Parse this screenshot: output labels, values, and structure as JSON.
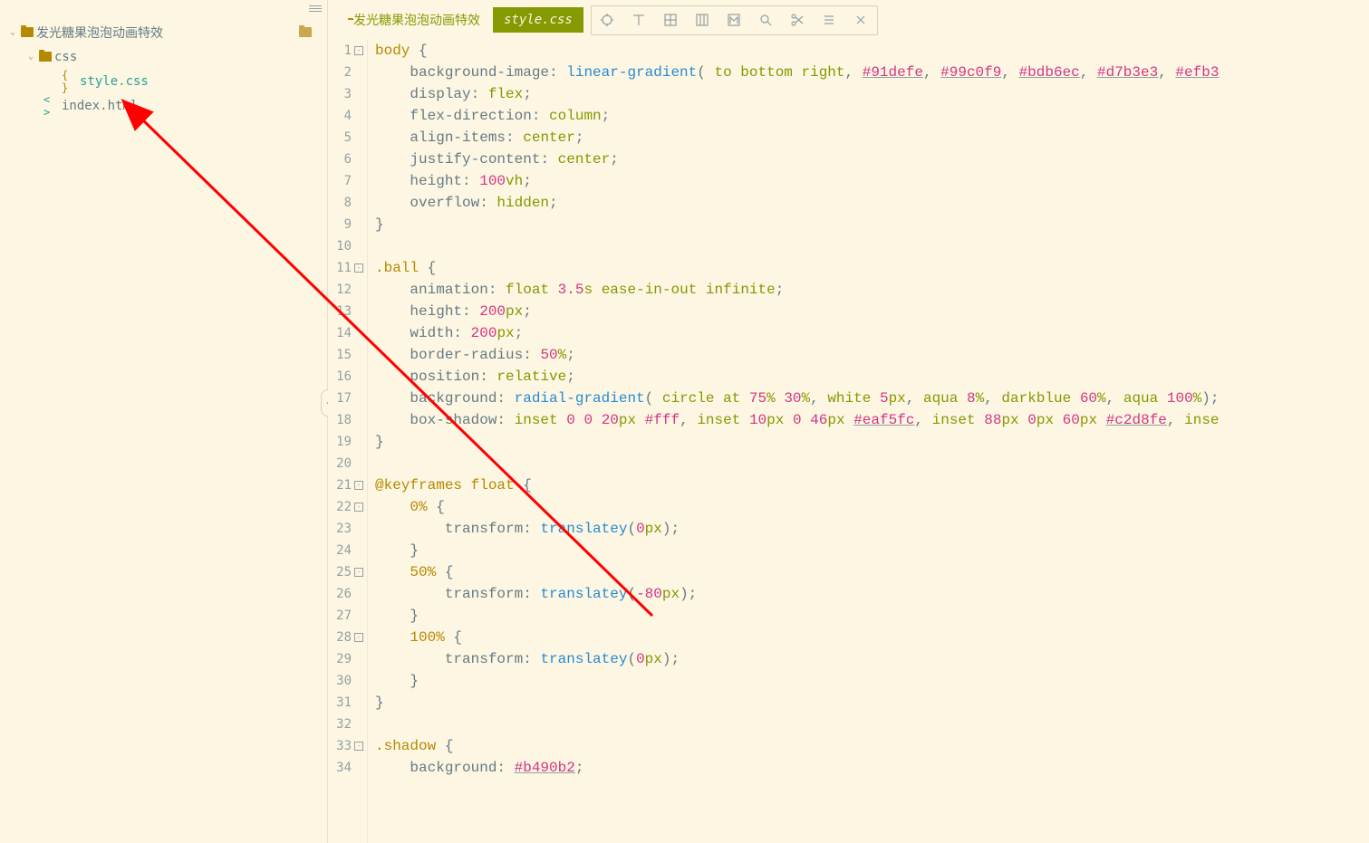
{
  "sidebar": {
    "root": {
      "label": "发光糖果泡泡动画特效"
    },
    "css_folder": {
      "label": "css"
    },
    "css_file": {
      "label": "style.css"
    },
    "html_file": {
      "label": "index.html"
    }
  },
  "tabs": {
    "folder": {
      "label": "发光糖果泡泡动画特效"
    },
    "active": {
      "label": "style.css"
    }
  },
  "toolbar_icons": [
    "target",
    "t",
    "grid4",
    "grid3col",
    "m",
    "search",
    "scissors",
    "menu",
    "close"
  ],
  "code": {
    "lines": [
      {
        "n": 1,
        "fold": "-",
        "tokens": [
          [
            "kw-sel",
            "body"
          ],
          [
            "punc",
            " "
          ],
          [
            "brace",
            "{"
          ]
        ]
      },
      {
        "n": 2,
        "tokens": [
          [
            "kw-prop",
            "    background-image"
          ],
          [
            "punc",
            ": "
          ],
          [
            "func",
            "linear-gradient"
          ],
          [
            "punc",
            "( "
          ],
          [
            "kw",
            "to"
          ],
          [
            "punc",
            " "
          ],
          [
            "kw",
            "bottom"
          ],
          [
            "punc",
            " "
          ],
          [
            "kw",
            "right"
          ],
          [
            "punc",
            ", "
          ],
          [
            "hex-u",
            "#91defe"
          ],
          [
            "punc",
            ", "
          ],
          [
            "hex-u",
            "#99c0f9"
          ],
          [
            "punc",
            ", "
          ],
          [
            "hex-u",
            "#bdb6ec"
          ],
          [
            "punc",
            ", "
          ],
          [
            "hex-u",
            "#d7b3e3"
          ],
          [
            "punc",
            ", "
          ],
          [
            "hex-u",
            "#efb3"
          ]
        ]
      },
      {
        "n": 3,
        "tokens": [
          [
            "kw-prop",
            "    display"
          ],
          [
            "punc",
            ": "
          ],
          [
            "kw",
            "flex"
          ],
          [
            "punc",
            ";"
          ]
        ]
      },
      {
        "n": 4,
        "tokens": [
          [
            "kw-prop",
            "    flex-direction"
          ],
          [
            "punc",
            ": "
          ],
          [
            "kw",
            "column"
          ],
          [
            "punc",
            ";"
          ]
        ]
      },
      {
        "n": 5,
        "tokens": [
          [
            "kw-prop",
            "    align-items"
          ],
          [
            "punc",
            ": "
          ],
          [
            "kw",
            "center"
          ],
          [
            "punc",
            ";"
          ]
        ]
      },
      {
        "n": 6,
        "tokens": [
          [
            "kw-prop",
            "    justify-content"
          ],
          [
            "punc",
            ": "
          ],
          [
            "kw",
            "center"
          ],
          [
            "punc",
            ";"
          ]
        ]
      },
      {
        "n": 7,
        "tokens": [
          [
            "kw-prop",
            "    height"
          ],
          [
            "punc",
            ": "
          ],
          [
            "num",
            "100"
          ],
          [
            "unit",
            "vh"
          ],
          [
            "punc",
            ";"
          ]
        ]
      },
      {
        "n": 8,
        "tokens": [
          [
            "kw-prop",
            "    overflow"
          ],
          [
            "punc",
            ": "
          ],
          [
            "kw",
            "hidden"
          ],
          [
            "punc",
            ";"
          ]
        ]
      },
      {
        "n": 9,
        "tokens": [
          [
            "brace",
            "}"
          ]
        ]
      },
      {
        "n": 10,
        "tokens": []
      },
      {
        "n": 11,
        "fold": "-",
        "tokens": [
          [
            "kw-sel",
            ".ball"
          ],
          [
            "punc",
            " "
          ],
          [
            "brace",
            "{"
          ]
        ]
      },
      {
        "n": 12,
        "tokens": [
          [
            "kw-prop",
            "    animation"
          ],
          [
            "punc",
            ": "
          ],
          [
            "kw",
            "float"
          ],
          [
            "punc",
            " "
          ],
          [
            "num",
            "3.5"
          ],
          [
            "unit",
            "s"
          ],
          [
            "punc",
            " "
          ],
          [
            "kw",
            "ease-in-out"
          ],
          [
            "punc",
            " "
          ],
          [
            "kw",
            "infinite"
          ],
          [
            "punc",
            ";"
          ]
        ]
      },
      {
        "n": 13,
        "tokens": [
          [
            "kw-prop",
            "    height"
          ],
          [
            "punc",
            ": "
          ],
          [
            "num",
            "200"
          ],
          [
            "unit",
            "px"
          ],
          [
            "punc",
            ";"
          ]
        ]
      },
      {
        "n": 14,
        "tokens": [
          [
            "kw-prop",
            "    width"
          ],
          [
            "punc",
            ": "
          ],
          [
            "num",
            "200"
          ],
          [
            "unit",
            "px"
          ],
          [
            "punc",
            ";"
          ]
        ]
      },
      {
        "n": 15,
        "tokens": [
          [
            "kw-prop",
            "    border-radius"
          ],
          [
            "punc",
            ": "
          ],
          [
            "num",
            "50"
          ],
          [
            "unit",
            "%"
          ],
          [
            "punc",
            ";"
          ]
        ]
      },
      {
        "n": 16,
        "tokens": [
          [
            "kw-prop",
            "    position"
          ],
          [
            "punc",
            ": "
          ],
          [
            "kw",
            "relative"
          ],
          [
            "punc",
            ";"
          ]
        ]
      },
      {
        "n": 17,
        "tokens": [
          [
            "kw-prop",
            "    background"
          ],
          [
            "punc",
            ": "
          ],
          [
            "func",
            "radial-gradient"
          ],
          [
            "punc",
            "( "
          ],
          [
            "kw",
            "circle"
          ],
          [
            "punc",
            " "
          ],
          [
            "kw",
            "at"
          ],
          [
            "punc",
            " "
          ],
          [
            "num",
            "75"
          ],
          [
            "unit",
            "%"
          ],
          [
            "punc",
            " "
          ],
          [
            "num",
            "30"
          ],
          [
            "unit",
            "%"
          ],
          [
            "punc",
            ", "
          ],
          [
            "kw",
            "white"
          ],
          [
            "punc",
            " "
          ],
          [
            "num",
            "5"
          ],
          [
            "unit",
            "px"
          ],
          [
            "punc",
            ", "
          ],
          [
            "kw",
            "aqua"
          ],
          [
            "punc",
            " "
          ],
          [
            "num",
            "8"
          ],
          [
            "unit",
            "%"
          ],
          [
            "punc",
            ", "
          ],
          [
            "kw",
            "darkblue"
          ],
          [
            "punc",
            " "
          ],
          [
            "num",
            "60"
          ],
          [
            "unit",
            "%"
          ],
          [
            "punc",
            ", "
          ],
          [
            "kw",
            "aqua"
          ],
          [
            "punc",
            " "
          ],
          [
            "num",
            "100"
          ],
          [
            "unit",
            "%"
          ],
          [
            "punc",
            ");"
          ]
        ]
      },
      {
        "n": 18,
        "tokens": [
          [
            "kw-prop",
            "    box-shadow"
          ],
          [
            "punc",
            ": "
          ],
          [
            "kw",
            "inset"
          ],
          [
            "punc",
            " "
          ],
          [
            "num",
            "0"
          ],
          [
            "punc",
            " "
          ],
          [
            "num",
            "0"
          ],
          [
            "punc",
            " "
          ],
          [
            "num",
            "20"
          ],
          [
            "unit",
            "px"
          ],
          [
            "punc",
            " "
          ],
          [
            "hex",
            "#fff"
          ],
          [
            "punc",
            ", "
          ],
          [
            "kw",
            "inset"
          ],
          [
            "punc",
            " "
          ],
          [
            "num",
            "10"
          ],
          [
            "unit",
            "px"
          ],
          [
            "punc",
            " "
          ],
          [
            "num",
            "0"
          ],
          [
            "punc",
            " "
          ],
          [
            "num",
            "46"
          ],
          [
            "unit",
            "px"
          ],
          [
            "punc",
            " "
          ],
          [
            "hex-u",
            "#eaf5fc"
          ],
          [
            "punc",
            ", "
          ],
          [
            "kw",
            "inset"
          ],
          [
            "punc",
            " "
          ],
          [
            "num",
            "88"
          ],
          [
            "unit",
            "px"
          ],
          [
            "punc",
            " "
          ],
          [
            "num",
            "0"
          ],
          [
            "unit",
            "px"
          ],
          [
            "punc",
            " "
          ],
          [
            "num",
            "60"
          ],
          [
            "unit",
            "px"
          ],
          [
            "punc",
            " "
          ],
          [
            "hex-u",
            "#c2d8fe"
          ],
          [
            "punc",
            ", "
          ],
          [
            "kw",
            "inse"
          ]
        ]
      },
      {
        "n": 19,
        "tokens": [
          [
            "brace",
            "}"
          ]
        ]
      },
      {
        "n": 20,
        "tokens": []
      },
      {
        "n": 21,
        "fold": "-",
        "tokens": [
          [
            "atrule",
            "@keyframes"
          ],
          [
            "punc",
            " "
          ],
          [
            "kw-sel",
            "float"
          ],
          [
            "punc",
            " "
          ],
          [
            "brace",
            "{"
          ]
        ]
      },
      {
        "n": 22,
        "fold": "-",
        "tokens": [
          [
            "kw-sel",
            "    0%"
          ],
          [
            "punc",
            " "
          ],
          [
            "brace",
            "{"
          ]
        ]
      },
      {
        "n": 23,
        "tokens": [
          [
            "kw-prop",
            "        transform"
          ],
          [
            "punc",
            ": "
          ],
          [
            "func",
            "translatey"
          ],
          [
            "punc",
            "("
          ],
          [
            "num",
            "0"
          ],
          [
            "unit",
            "px"
          ],
          [
            "punc",
            ");"
          ]
        ]
      },
      {
        "n": 24,
        "tokens": [
          [
            "brace",
            "    }"
          ]
        ]
      },
      {
        "n": 25,
        "fold": "-",
        "tokens": [
          [
            "kw-sel",
            "    50%"
          ],
          [
            "punc",
            " "
          ],
          [
            "brace",
            "{"
          ]
        ]
      },
      {
        "n": 26,
        "tokens": [
          [
            "kw-prop",
            "        transform"
          ],
          [
            "punc",
            ": "
          ],
          [
            "func",
            "translatey"
          ],
          [
            "punc",
            "("
          ],
          [
            "num",
            "-80"
          ],
          [
            "unit",
            "px"
          ],
          [
            "punc",
            ");"
          ]
        ]
      },
      {
        "n": 27,
        "tokens": [
          [
            "brace",
            "    }"
          ]
        ]
      },
      {
        "n": 28,
        "fold": "-",
        "tokens": [
          [
            "kw-sel",
            "    100%"
          ],
          [
            "punc",
            " "
          ],
          [
            "brace",
            "{"
          ]
        ]
      },
      {
        "n": 29,
        "tokens": [
          [
            "kw-prop",
            "        transform"
          ],
          [
            "punc",
            ": "
          ],
          [
            "func",
            "translatey"
          ],
          [
            "punc",
            "("
          ],
          [
            "num",
            "0"
          ],
          [
            "unit",
            "px"
          ],
          [
            "punc",
            ");"
          ]
        ]
      },
      {
        "n": 30,
        "tokens": [
          [
            "brace",
            "    }"
          ]
        ]
      },
      {
        "n": 31,
        "tokens": [
          [
            "brace",
            "}"
          ]
        ]
      },
      {
        "n": 32,
        "tokens": []
      },
      {
        "n": 33,
        "fold": "-",
        "tokens": [
          [
            "kw-sel",
            ".shadow"
          ],
          [
            "punc",
            " "
          ],
          [
            "brace",
            "{"
          ]
        ]
      },
      {
        "n": 34,
        "tokens": [
          [
            "kw-prop",
            "    background"
          ],
          [
            "punc",
            ": "
          ],
          [
            "hex-u",
            "#b490b2"
          ],
          [
            "punc",
            ";"
          ]
        ]
      }
    ]
  }
}
